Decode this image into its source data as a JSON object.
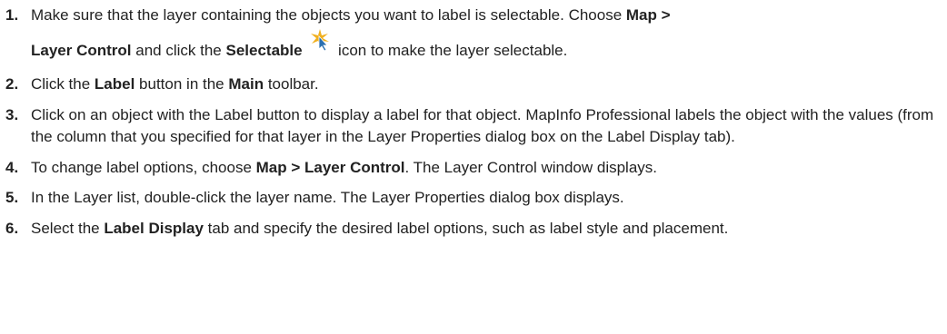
{
  "steps": [
    {
      "num": "1.",
      "t1": "Make sure that the layer containing the objects you want to label is selectable. Choose ",
      "b1": "Map >",
      "b2": "Layer Control",
      "t2": " and click the ",
      "b3": "Selectable",
      "icon": "selectable-icon",
      "t3": " icon to make the layer selectable."
    },
    {
      "num": "2.",
      "t1": "Click the ",
      "b1": "Label",
      "t2": " button in the ",
      "b2": "Main",
      "t3": " toolbar."
    },
    {
      "num": "3.",
      "t1": "Click on an object with the Label button to display a label for that object. MapInfo Professional labels the object with the values (from the column that you specified for that layer in the Layer Properties dialog box on the Label Display tab)."
    },
    {
      "num": "4.",
      "t1": "To change label options, choose ",
      "b1": "Map > Layer Control",
      "t2": ". The Layer Control window displays."
    },
    {
      "num": "5.",
      "t1": "In the Layer list, double-click the layer name. The Layer Properties dialog box displays."
    },
    {
      "num": "6.",
      "t1": "Select the ",
      "b1": "Label Display",
      "t2": " tab and specify the desired label options, such as label style and placement."
    }
  ],
  "colors": {
    "text": "#222222",
    "icon_star": "#f0b020",
    "icon_arrow": "#2a6fb0"
  }
}
